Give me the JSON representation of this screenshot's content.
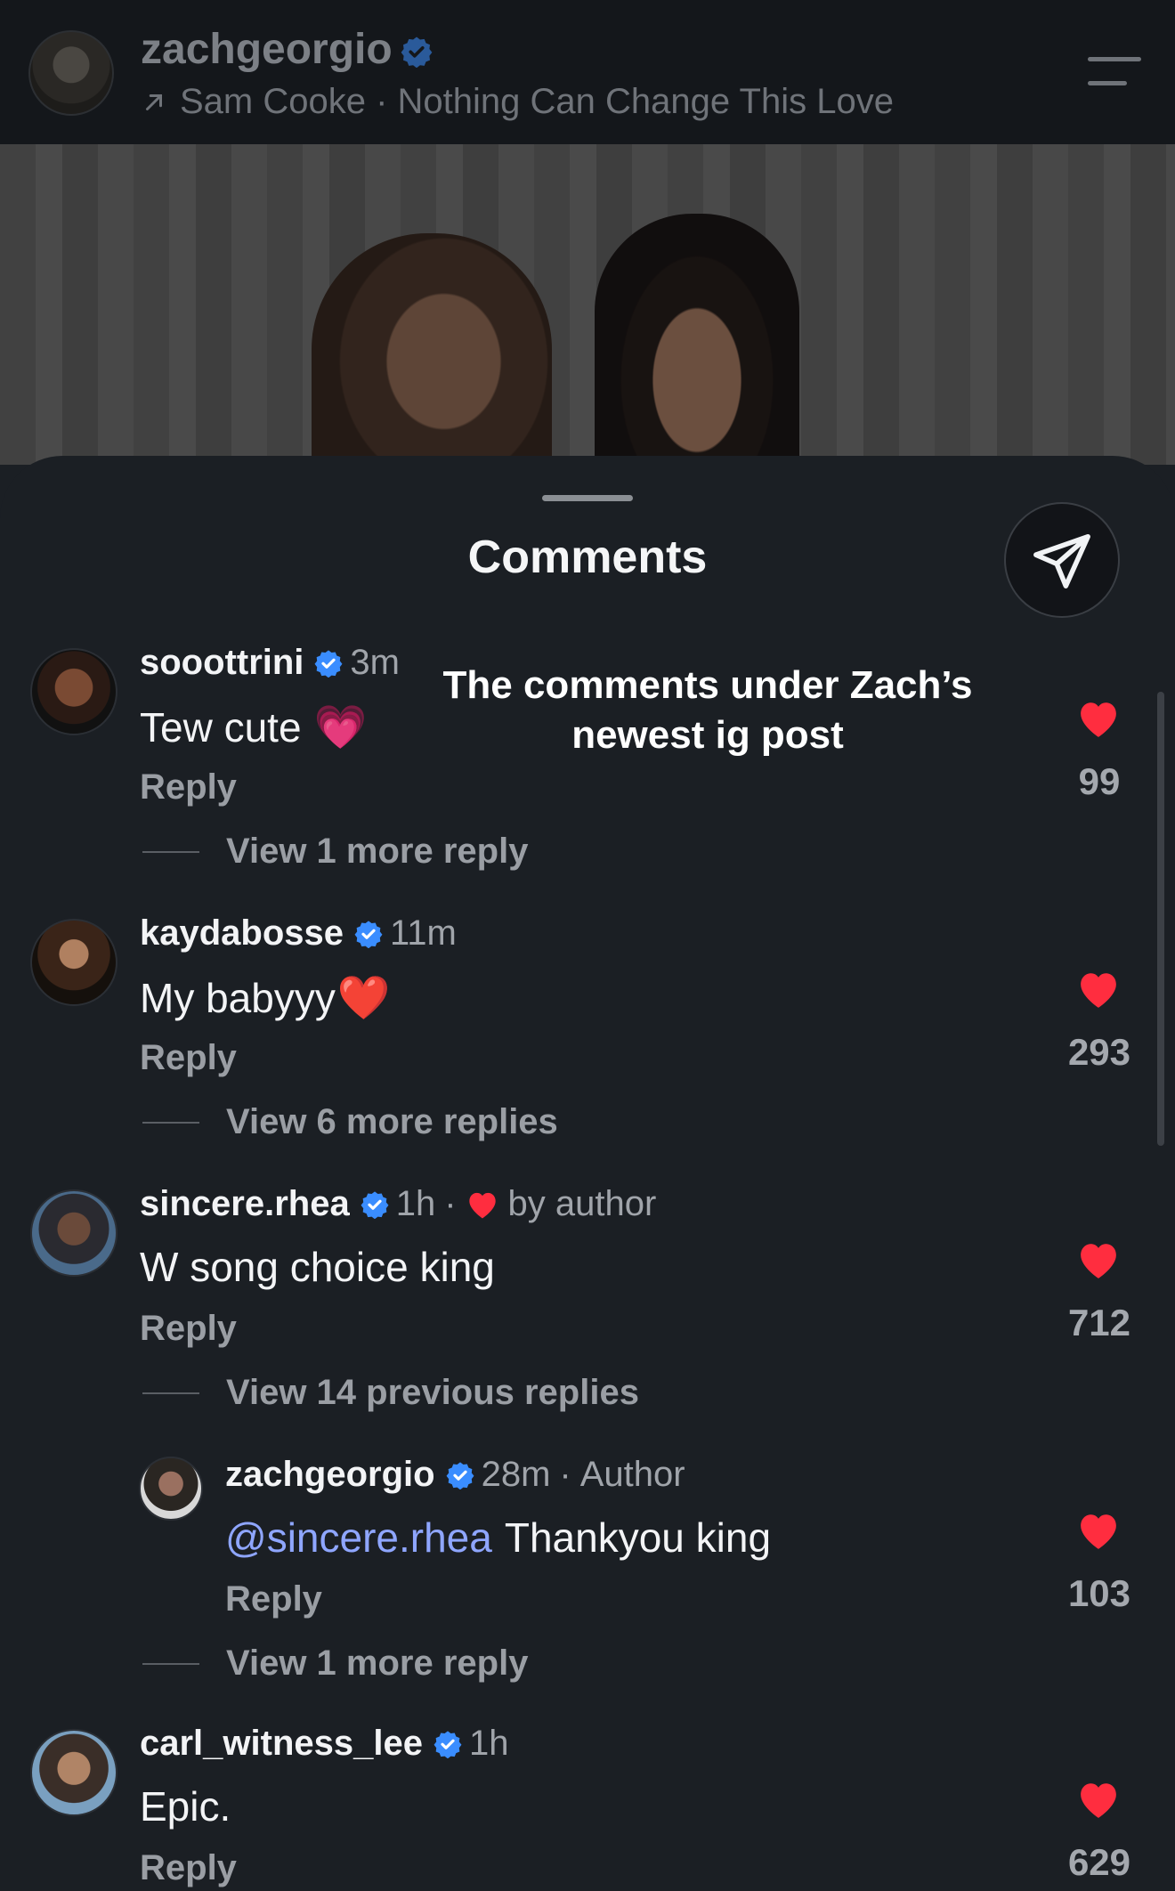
{
  "header": {
    "username": "zachgeorgio",
    "song": "Sam Cooke · Nothing Can Change This Love"
  },
  "sheet": {
    "title": "Comments",
    "overlay_caption": "The comments under Zach’s newest ig post"
  },
  "comments": [
    {
      "username": "sooottrini",
      "time": "3m",
      "text": "Tew cute",
      "emoji": "💗",
      "reply_label": "Reply",
      "likes": "99",
      "view_more": "View 1 more reply"
    },
    {
      "username": "kaydabosse",
      "time": "11m",
      "text": "My babyyy",
      "emoji": "❤️",
      "reply_label": "Reply",
      "likes": "293",
      "view_more": "View 6 more replies"
    },
    {
      "username": "sincere.rhea",
      "time": "1h",
      "liked_by": "by author",
      "text": "W song choice king",
      "reply_label": "Reply",
      "likes": "712",
      "view_more": "View 14 previous replies"
    },
    {
      "username": "zachgeorgio",
      "time": "28m",
      "role": "Author",
      "mention": "@sincere.rhea",
      "text": "Thankyou king",
      "reply_label": "Reply",
      "likes": "103",
      "view_more": "View 1 more reply"
    },
    {
      "username": "carl_witness_lee",
      "time": "1h",
      "text": "Epic.",
      "reply_label": "Reply",
      "likes": "629"
    }
  ],
  "icons": {
    "verified": "verified-badge-icon",
    "like": "heart-icon",
    "share": "paper-plane-icon",
    "menu": "menu-icon",
    "song": "arrow-up-right-icon"
  },
  "colors": {
    "like": "#ff2d3f",
    "verified": "#3a8dff",
    "mention": "#8fa6ff"
  }
}
